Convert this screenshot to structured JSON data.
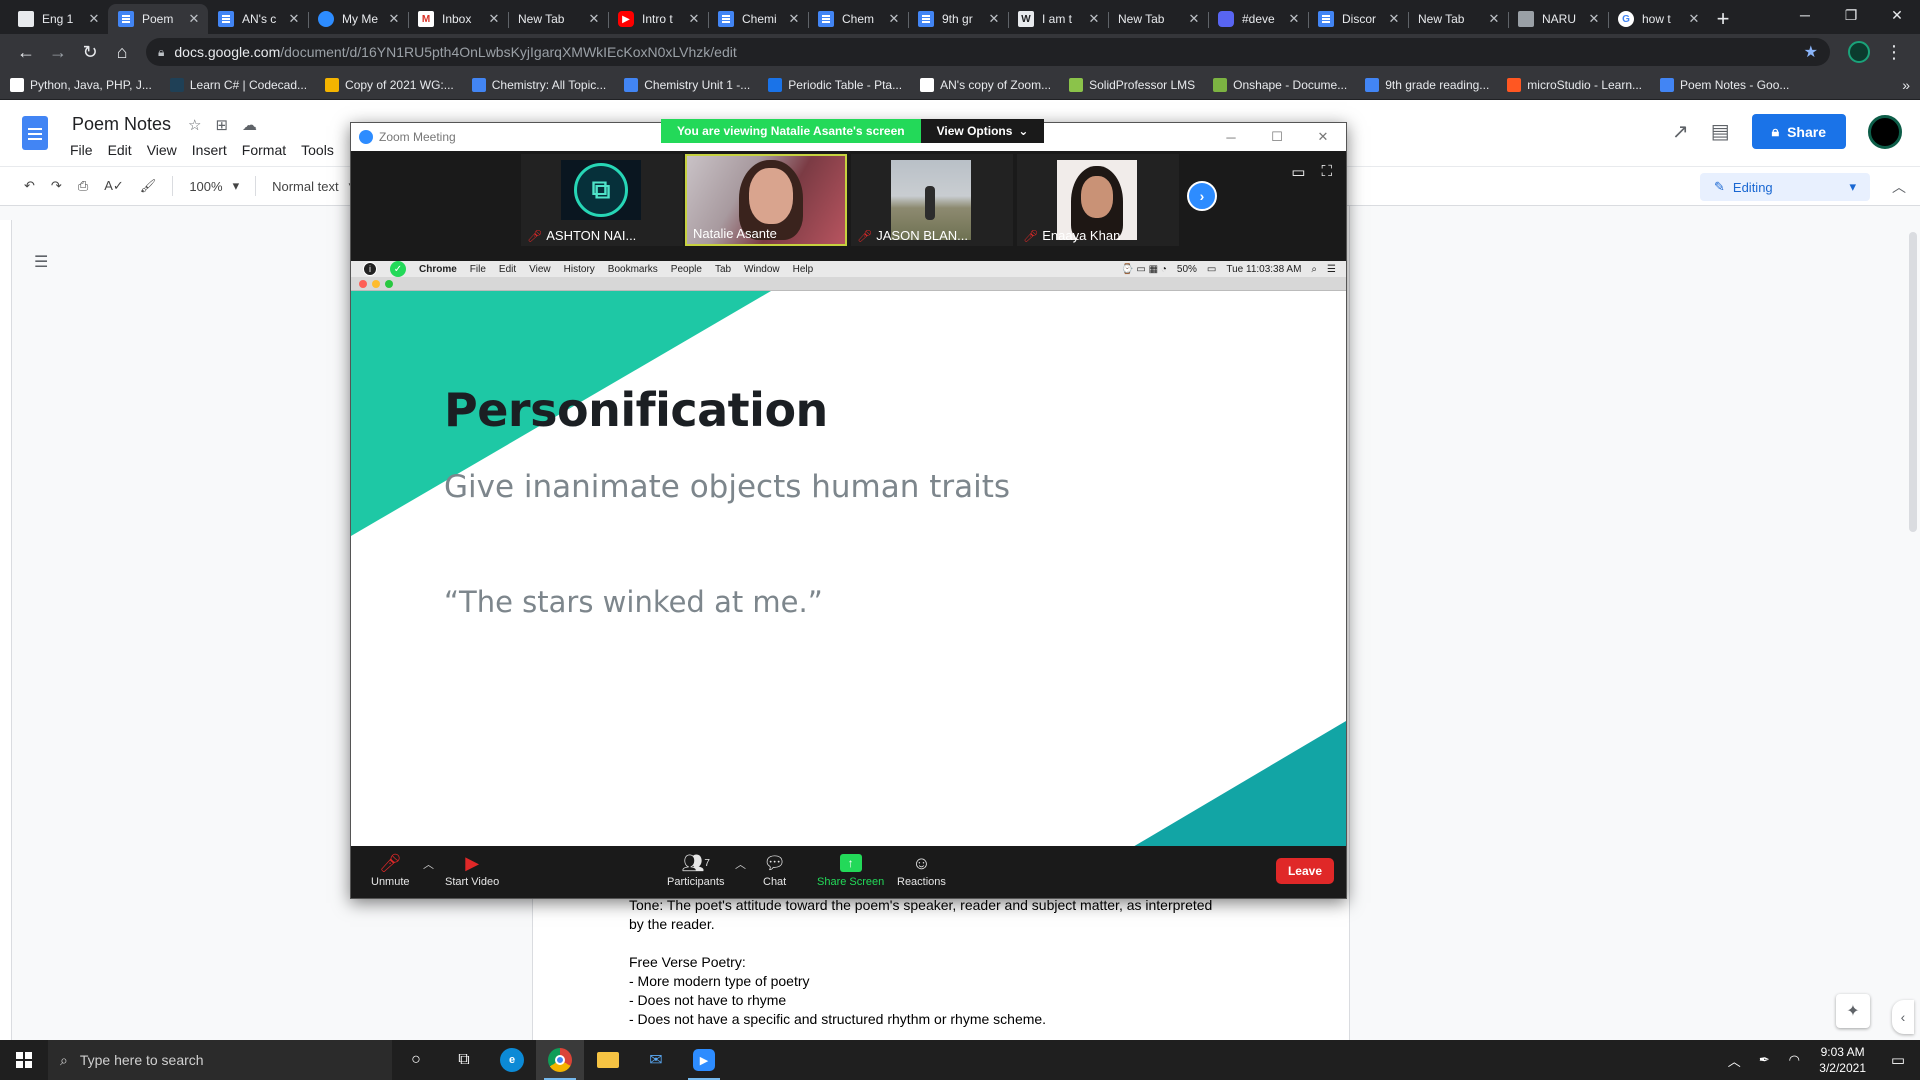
{
  "browser": {
    "tabs": [
      {
        "label": "Eng 1",
        "icon": "slides-icon",
        "fav": "slides",
        "active": false
      },
      {
        "label": "Poem",
        "icon": "docs-icon",
        "fav": "docs",
        "active": true
      },
      {
        "label": "AN's c",
        "icon": "docs-icon",
        "fav": "docs",
        "active": false
      },
      {
        "label": "My Me",
        "icon": "zoom-icon",
        "fav": "zoom",
        "active": false
      },
      {
        "label": "Inbox",
        "icon": "gmail-icon",
        "fav": "gmail",
        "active": false
      },
      {
        "label": "New Tab",
        "icon": "",
        "fav": "",
        "active": false
      },
      {
        "label": "Intro t",
        "icon": "youtube-icon",
        "fav": "yt",
        "active": false
      },
      {
        "label": "Chemi",
        "icon": "docs-icon",
        "fav": "docs",
        "active": false
      },
      {
        "label": "Chem",
        "icon": "docs-icon",
        "fav": "docs",
        "active": false
      },
      {
        "label": "9th gr",
        "icon": "docs-icon",
        "fav": "docs",
        "active": false
      },
      {
        "label": "I am t",
        "icon": "wiki-icon",
        "fav": "wiki",
        "active": false
      },
      {
        "label": "New Tab",
        "icon": "",
        "fav": "",
        "active": false
      },
      {
        "label": "#deve",
        "icon": "discord-icon",
        "fav": "discord",
        "active": false
      },
      {
        "label": "Discor",
        "icon": "docs-icon",
        "fav": "docs",
        "active": false
      },
      {
        "label": "New Tab",
        "icon": "",
        "fav": "",
        "active": false
      },
      {
        "label": "NARU",
        "icon": "anime-icon",
        "fav": "anime",
        "active": false
      },
      {
        "label": "how t",
        "icon": "google-icon",
        "fav": "google",
        "active": false
      }
    ],
    "url_host": "docs.google.com",
    "url_path": "/document/d/16YN1RU5pth4OnLwbsKyjIgarqXMWkIEcKoxN0xLVhzk/edit",
    "bookmarks": [
      {
        "label": "Python, Java, PHP, J...",
        "color": "#ffffff"
      },
      {
        "label": "Learn C# | Codecad...",
        "color": "#1f4056"
      },
      {
        "label": "Copy of 2021 WG:...",
        "color": "#f4b400"
      },
      {
        "label": "Chemistry: All Topic...",
        "color": "#4285f4"
      },
      {
        "label": "Chemistry Unit 1 -...",
        "color": "#4285f4"
      },
      {
        "label": "Periodic Table - Pta...",
        "color": "#1a73e8"
      },
      {
        "label": "AN's copy of Zoom...",
        "color": "#ffffff"
      },
      {
        "label": "SolidProfessor LMS",
        "color": "#8bc34a"
      },
      {
        "label": "Onshape - Docume...",
        "color": "#7cb342"
      },
      {
        "label": "9th grade reading...",
        "color": "#4285f4"
      },
      {
        "label": "microStudio - Learn...",
        "color": "#ff5722"
      },
      {
        "label": "Poem Notes - Goo...",
        "color": "#4285f4"
      }
    ],
    "bookmarks_more": "»"
  },
  "docs": {
    "title": "Poem Notes",
    "menu": [
      "File",
      "Edit",
      "View",
      "Insert",
      "Format",
      "Tools"
    ],
    "share_label": "Share",
    "zoom_level": "100%",
    "style": "Normal text",
    "mode": "Editing",
    "body_lines": [
      "Tone: The poet's attitude toward the poem's speaker, reader and subject matter, as interpreted",
      "by the reader.",
      "",
      "Free Verse Poetry:",
      "- More modern type of poetry",
      "- Does not have to rhyme",
      "- Does not have a specific and structured rhythm or rhyme scheme."
    ]
  },
  "zoom": {
    "window_title": "Zoom Meeting",
    "viewing_banner": "You are viewing Natalie Asante's screen",
    "view_options": "View Options",
    "participants": [
      {
        "name": "ASHTON NAI...",
        "muted": true,
        "active": false
      },
      {
        "name": "Natalie Asante",
        "muted": false,
        "active": true
      },
      {
        "name": "JASON BLAN...",
        "muted": true,
        "active": false
      },
      {
        "name": "Enaaya Khan",
        "muted": true,
        "active": false
      }
    ],
    "shared_screen": {
      "menu": [
        "Chrome",
        "File",
        "Edit",
        "View",
        "History",
        "Bookmarks",
        "People",
        "Tab",
        "Window",
        "Help"
      ],
      "battery": "50%",
      "clock": "Tue 11:03:38 AM",
      "slide_title": "Personification",
      "slide_subtitle": "Give inanimate objects human traits",
      "slide_quote": "“The stars winked at me.”",
      "accent_color": "#1ec8a5",
      "accent_color_2": "#12a5a5"
    },
    "controls": {
      "unmute": "Unmute",
      "start_video": "Start Video",
      "participants": "Participants",
      "participant_count": "7",
      "chat": "Chat",
      "share_screen": "Share Screen",
      "reactions": "Reactions",
      "leave": "Leave"
    }
  },
  "taskbar": {
    "search_placeholder": "Type here to search",
    "time": "9:03 AM",
    "date": "3/2/2021"
  }
}
